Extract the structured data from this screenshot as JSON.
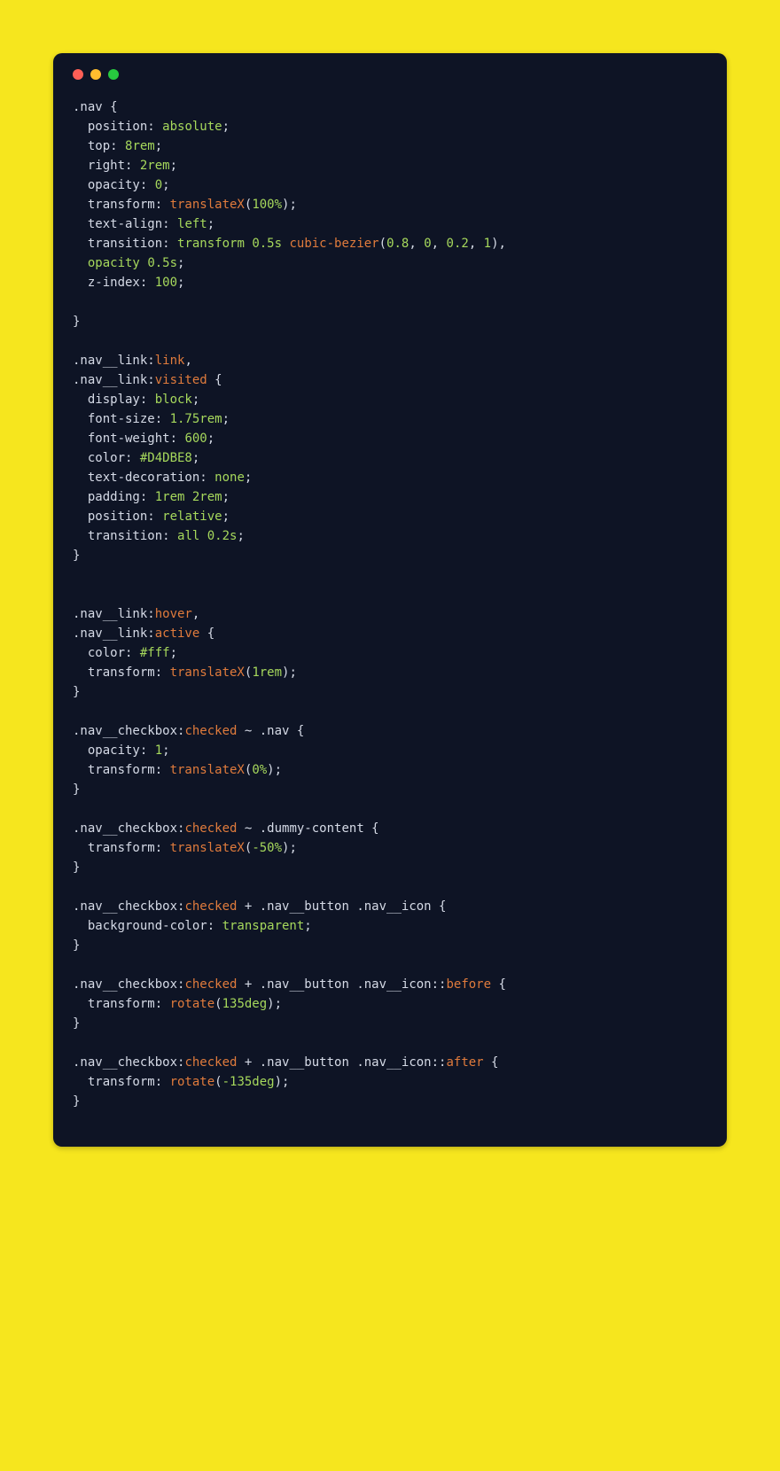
{
  "colors": {
    "page_bg": "#f6e61e",
    "window_bg": "#0e1425",
    "text": "#d5dae6",
    "keyword": "#a6d85c",
    "function": "#e07b3c",
    "number": "#a6d85c"
  },
  "code": {
    "tokens": [
      [
        [
          "t",
          ".nav {"
        ]
      ],
      [
        [
          "t",
          "  position: "
        ],
        [
          "k",
          "absolute"
        ],
        [
          "t",
          ";"
        ]
      ],
      [
        [
          "t",
          "  top: "
        ],
        [
          "n",
          "8rem"
        ],
        [
          "t",
          ";"
        ]
      ],
      [
        [
          "t",
          "  right: "
        ],
        [
          "n",
          "2rem"
        ],
        [
          "t",
          ";"
        ]
      ],
      [
        [
          "t",
          "  opacity: "
        ],
        [
          "n",
          "0"
        ],
        [
          "t",
          ";"
        ]
      ],
      [
        [
          "t",
          "  transform: "
        ],
        [
          "f",
          "translateX"
        ],
        [
          "t",
          "("
        ],
        [
          "n",
          "100%"
        ],
        [
          "t",
          ");"
        ]
      ],
      [
        [
          "t",
          "  text-align: "
        ],
        [
          "k",
          "left"
        ],
        [
          "t",
          ";"
        ]
      ],
      [
        [
          "t",
          "  transition: "
        ],
        [
          "k",
          "transform"
        ],
        [
          "t",
          " "
        ],
        [
          "n",
          "0.5s"
        ],
        [
          "t",
          " "
        ],
        [
          "f",
          "cubic-bezier"
        ],
        [
          "t",
          "("
        ],
        [
          "n",
          "0.8"
        ],
        [
          "t",
          ", "
        ],
        [
          "n",
          "0"
        ],
        [
          "t",
          ", "
        ],
        [
          "n",
          "0.2"
        ],
        [
          "t",
          ", "
        ],
        [
          "n",
          "1"
        ],
        [
          "t",
          "),"
        ]
      ],
      [
        [
          "t",
          "  "
        ],
        [
          "k",
          "opacity"
        ],
        [
          "t",
          " "
        ],
        [
          "n",
          "0.5s"
        ],
        [
          "t",
          ";"
        ]
      ],
      [
        [
          "t",
          "  z-index: "
        ],
        [
          "n",
          "100"
        ],
        [
          "t",
          ";"
        ]
      ],
      [
        [
          "t",
          ""
        ]
      ],
      [
        [
          "t",
          "}"
        ]
      ],
      [
        [
          "t",
          ""
        ]
      ],
      [
        [
          "t",
          ".nav__link:"
        ],
        [
          "f",
          "link"
        ],
        [
          "t",
          ","
        ]
      ],
      [
        [
          "t",
          ".nav__link:"
        ],
        [
          "f",
          "visited"
        ],
        [
          "t",
          " {"
        ]
      ],
      [
        [
          "t",
          "  display: "
        ],
        [
          "k",
          "block"
        ],
        [
          "t",
          ";"
        ]
      ],
      [
        [
          "t",
          "  font-size: "
        ],
        [
          "n",
          "1.75rem"
        ],
        [
          "t",
          ";"
        ]
      ],
      [
        [
          "t",
          "  font-weight: "
        ],
        [
          "n",
          "600"
        ],
        [
          "t",
          ";"
        ]
      ],
      [
        [
          "t",
          "  color: "
        ],
        [
          "k",
          "#D4DBE8"
        ],
        [
          "t",
          ";"
        ]
      ],
      [
        [
          "t",
          "  text-decoration: "
        ],
        [
          "k",
          "none"
        ],
        [
          "t",
          ";"
        ]
      ],
      [
        [
          "t",
          "  padding: "
        ],
        [
          "n",
          "1rem"
        ],
        [
          "t",
          " "
        ],
        [
          "n",
          "2rem"
        ],
        [
          "t",
          ";"
        ]
      ],
      [
        [
          "t",
          "  position: "
        ],
        [
          "k",
          "relative"
        ],
        [
          "t",
          ";"
        ]
      ],
      [
        [
          "t",
          "  transition: "
        ],
        [
          "k",
          "all"
        ],
        [
          "t",
          " "
        ],
        [
          "n",
          "0.2s"
        ],
        [
          "t",
          ";"
        ]
      ],
      [
        [
          "t",
          "}"
        ]
      ],
      [
        [
          "t",
          ""
        ]
      ],
      [
        [
          "t",
          ""
        ]
      ],
      [
        [
          "t",
          ".nav__link:"
        ],
        [
          "f",
          "hover"
        ],
        [
          "t",
          ","
        ]
      ],
      [
        [
          "t",
          ".nav__link:"
        ],
        [
          "f",
          "active"
        ],
        [
          "t",
          " {"
        ]
      ],
      [
        [
          "t",
          "  color: "
        ],
        [
          "k",
          "#fff"
        ],
        [
          "t",
          ";"
        ]
      ],
      [
        [
          "t",
          "  transform: "
        ],
        [
          "f",
          "translateX"
        ],
        [
          "t",
          "("
        ],
        [
          "n",
          "1rem"
        ],
        [
          "t",
          ");"
        ]
      ],
      [
        [
          "t",
          "}"
        ]
      ],
      [
        [
          "t",
          ""
        ]
      ],
      [
        [
          "t",
          ".nav__checkbox:"
        ],
        [
          "f",
          "checked"
        ],
        [
          "t",
          " ~ .nav {"
        ]
      ],
      [
        [
          "t",
          "  opacity: "
        ],
        [
          "n",
          "1"
        ],
        [
          "t",
          ";"
        ]
      ],
      [
        [
          "t",
          "  transform: "
        ],
        [
          "f",
          "translateX"
        ],
        [
          "t",
          "("
        ],
        [
          "n",
          "0%"
        ],
        [
          "t",
          ");"
        ]
      ],
      [
        [
          "t",
          "}"
        ]
      ],
      [
        [
          "t",
          ""
        ]
      ],
      [
        [
          "t",
          ".nav__checkbox:"
        ],
        [
          "f",
          "checked"
        ],
        [
          "t",
          " ~ .dummy-content {"
        ]
      ],
      [
        [
          "t",
          "  transform: "
        ],
        [
          "f",
          "translateX"
        ],
        [
          "t",
          "("
        ],
        [
          "n",
          "-50%"
        ],
        [
          "t",
          ");"
        ]
      ],
      [
        [
          "t",
          "}"
        ]
      ],
      [
        [
          "t",
          ""
        ]
      ],
      [
        [
          "t",
          ".nav__checkbox:"
        ],
        [
          "f",
          "checked"
        ],
        [
          "t",
          " + .nav__button .nav__icon {"
        ]
      ],
      [
        [
          "t",
          "  background-color: "
        ],
        [
          "k",
          "transparent"
        ],
        [
          "t",
          ";"
        ]
      ],
      [
        [
          "t",
          "}"
        ]
      ],
      [
        [
          "t",
          ""
        ]
      ],
      [
        [
          "t",
          ".nav__checkbox:"
        ],
        [
          "f",
          "checked"
        ],
        [
          "t",
          " + .nav__button .nav__icon::"
        ],
        [
          "f",
          "before"
        ],
        [
          "t",
          " {"
        ]
      ],
      [
        [
          "t",
          "  transform: "
        ],
        [
          "f",
          "rotate"
        ],
        [
          "t",
          "("
        ],
        [
          "n",
          "135deg"
        ],
        [
          "t",
          ");"
        ]
      ],
      [
        [
          "t",
          "}"
        ]
      ],
      [
        [
          "t",
          ""
        ]
      ],
      [
        [
          "t",
          ".nav__checkbox:"
        ],
        [
          "f",
          "checked"
        ],
        [
          "t",
          " + .nav__button .nav__icon::"
        ],
        [
          "f",
          "after"
        ],
        [
          "t",
          " {"
        ]
      ],
      [
        [
          "t",
          "  transform: "
        ],
        [
          "f",
          "rotate"
        ],
        [
          "t",
          "("
        ],
        [
          "n",
          "-135deg"
        ],
        [
          "t",
          ");"
        ]
      ],
      [
        [
          "t",
          "}"
        ]
      ]
    ]
  }
}
